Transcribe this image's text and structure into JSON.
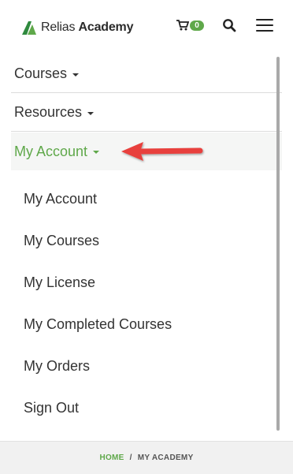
{
  "header": {
    "logo_text_regular": "Relias",
    "logo_text_bold": "Academy",
    "cart_count": "0",
    "colors": {
      "brand_green": "#5fa84a"
    }
  },
  "menu": {
    "items": [
      {
        "label": "Courses",
        "state": "collapsed"
      },
      {
        "label": "Resources",
        "state": "collapsed"
      },
      {
        "label": "My Account",
        "state": "expanded"
      }
    ],
    "submenu": [
      {
        "label": "My Account"
      },
      {
        "label": "My Courses"
      },
      {
        "label": "My License"
      },
      {
        "label": "My Completed Courses"
      },
      {
        "label": "My Orders"
      },
      {
        "label": "Sign Out"
      }
    ]
  },
  "annotation": {
    "arrow_color": "#e8413c"
  },
  "breadcrumb": {
    "home": "HOME",
    "separator": "/",
    "current": "MY ACADEMY"
  }
}
